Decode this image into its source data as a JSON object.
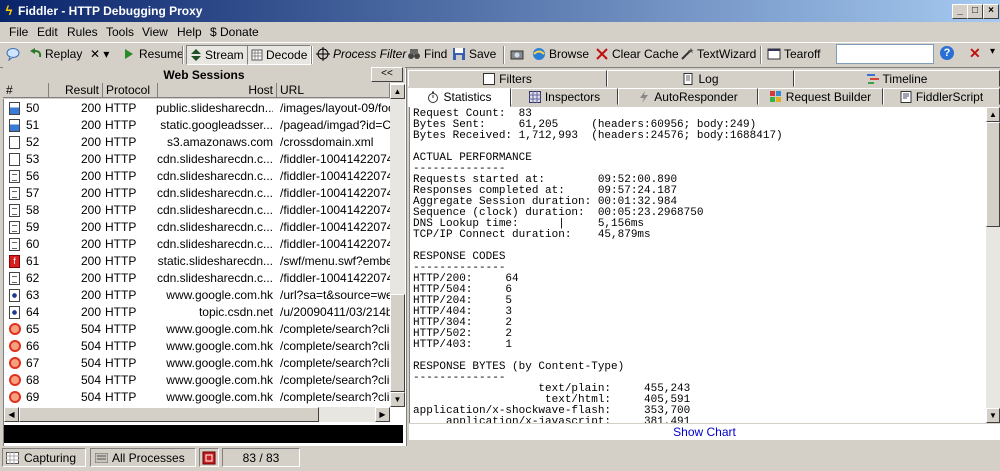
{
  "window": {
    "title": "Fiddler - HTTP Debugging Proxy",
    "min": "_",
    "max": "□",
    "close": "×"
  },
  "menu": [
    "File",
    "Edit",
    "Rules",
    "Tools",
    "View",
    "Help",
    "$ Donate"
  ],
  "toolbar": {
    "replay": "Replay",
    "remove": "✕ ▾",
    "resume": "Resume",
    "stream": "Stream",
    "decode": "Decode",
    "process_filter": "Process Filter",
    "find": "Find",
    "save": "Save",
    "browse": "Browse",
    "clear_cache": "Clear Cache",
    "text_wizard": "TextWizard",
    "tearoff": "Tearoff",
    "quickexec_value": "",
    "help_glyph": "?",
    "close_glyph": "✕",
    "more_glyph": "▾"
  },
  "sessions": {
    "header": "Web Sessions",
    "collapse": "<<",
    "columns": [
      "#",
      "Result",
      "Protocol",
      "Host",
      "URL"
    ],
    "rows": [
      {
        "id": "50",
        "result": "200",
        "protocol": "HTTP",
        "host": "public.slidesharecdn...",
        "url": "/images/layout-09/foo",
        "icon": "img"
      },
      {
        "id": "51",
        "result": "200",
        "protocol": "HTTP",
        "host": "static.googleadsser...",
        "url": "/pagead/imgad?id=CI",
        "icon": "img"
      },
      {
        "id": "52",
        "result": "200",
        "protocol": "HTTP",
        "host": "s3.amazonaws.com",
        "url": "/crossdomain.xml",
        "icon": "xml"
      },
      {
        "id": "53",
        "result": "200",
        "protocol": "HTTP",
        "host": "cdn.slidesharecdn.c...",
        "url": "/fiddler-1004142207485",
        "icon": "xml"
      },
      {
        "id": "56",
        "result": "200",
        "protocol": "HTTP",
        "host": "cdn.slidesharecdn.c...",
        "url": "/fiddler-1004142207485",
        "icon": "doc"
      },
      {
        "id": "57",
        "result": "200",
        "protocol": "HTTP",
        "host": "cdn.slidesharecdn.c...",
        "url": "/fiddler-1004142207485",
        "icon": "doc"
      },
      {
        "id": "58",
        "result": "200",
        "protocol": "HTTP",
        "host": "cdn.slidesharecdn.c...",
        "url": "/fiddler-1004142207485",
        "icon": "doc"
      },
      {
        "id": "59",
        "result": "200",
        "protocol": "HTTP",
        "host": "cdn.slidesharecdn.c...",
        "url": "/fiddler-1004142207485",
        "icon": "doc"
      },
      {
        "id": "60",
        "result": "200",
        "protocol": "HTTP",
        "host": "cdn.slidesharecdn.c...",
        "url": "/fiddler-1004142207485",
        "icon": "doc"
      },
      {
        "id": "61",
        "result": "200",
        "protocol": "HTTP",
        "host": "static.slidesharecdn...",
        "url": "/swf/menu.swf?embed",
        "icon": "flash"
      },
      {
        "id": "62",
        "result": "200",
        "protocol": "HTTP",
        "host": "cdn.slidesharecdn.c...",
        "url": "/fiddler-1004142207485",
        "icon": "doc"
      },
      {
        "id": "63",
        "result": "200",
        "protocol": "HTTP",
        "host": "www.google.com.hk",
        "url": "/url?sa=t&source=wel",
        "icon": "redirect"
      },
      {
        "id": "64",
        "result": "200",
        "protocol": "HTTP",
        "host": "topic.csdn.net",
        "url": "/u/20090411/03/214b",
        "icon": "redirect"
      },
      {
        "id": "65",
        "result": "504",
        "protocol": "HTTP",
        "host": "www.google.com.hk",
        "url": "/complete/search?clier",
        "icon": "block"
      },
      {
        "id": "66",
        "result": "504",
        "protocol": "HTTP",
        "host": "www.google.com.hk",
        "url": "/complete/search?clier",
        "icon": "block"
      },
      {
        "id": "67",
        "result": "504",
        "protocol": "HTTP",
        "host": "www.google.com.hk",
        "url": "/complete/search?clier",
        "icon": "block"
      },
      {
        "id": "68",
        "result": "504",
        "protocol": "HTTP",
        "host": "www.google.com.hk",
        "url": "/complete/search?clier",
        "icon": "block"
      },
      {
        "id": "69",
        "result": "504",
        "protocol": "HTTP",
        "host": "www.google.com.hk",
        "url": "/complete/search?clier",
        "icon": "block"
      }
    ]
  },
  "tabs_top": [
    "Filters",
    "Log",
    "Timeline"
  ],
  "tabs_bottom": [
    "Statistics",
    "Inspectors",
    "AutoResponder",
    "Request Builder",
    "FiddlerScript"
  ],
  "stats_text": "Request Count:  83\nBytes Sent:     61,205     (headers:60956; body:249)\nBytes Received: 1,712,993  (headers:24576; body:1688417)\n\nACTUAL PERFORMANCE\n--------------\nRequests started at:        09:52:00.890\nResponses completed at:     09:57:24.187\nAggregate Session duration: 00:01:32.984\nSequence (clock) duration:  00:05:23.2968750\nDNS Lookup time:      |     5,156ms\nTCP/IP Connect duration:    45,879ms\n\nRESPONSE CODES\n--------------\nHTTP/200:     64\nHTTP/504:     6\nHTTP/204:     5\nHTTP/404:     3\nHTTP/304:     2\nHTTP/502:     2\nHTTP/403:     1\n\nRESPONSE BYTES (by Content-Type)\n--------------\n                   text/plain:     455,243\n                    text/html:     405,591\napplication/x-shockwave-flash:     353,700\n     application/x-javascript:     381,491",
  "show_chart": "Show Chart",
  "status": {
    "capturing": "Capturing",
    "processes": "All Processes",
    "count": "83 / 83"
  }
}
